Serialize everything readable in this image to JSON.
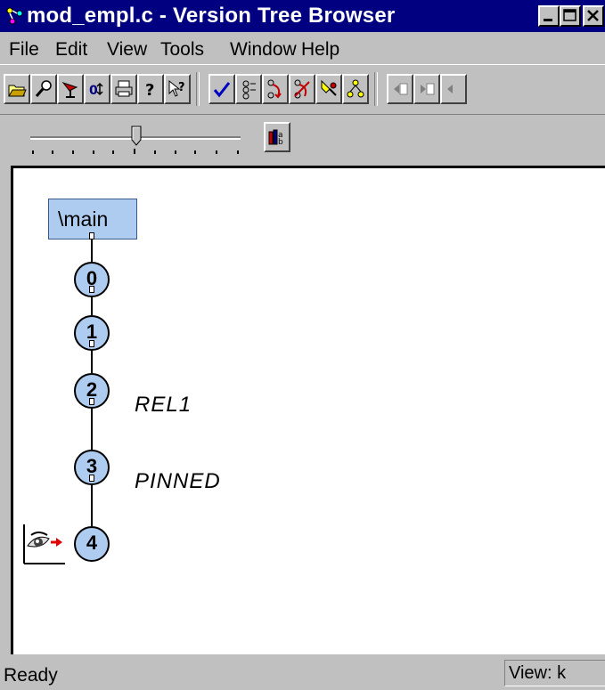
{
  "window": {
    "title": "mod_empl.c - Version Tree Browser"
  },
  "menu": [
    {
      "label": "File"
    },
    {
      "label": "Edit"
    },
    {
      "label": "View"
    },
    {
      "label": "Tools"
    },
    {
      "label": "Window"
    },
    {
      "label": "Help"
    }
  ],
  "toolbar": {
    "buttons": [
      "open-folder-icon",
      "magnifier-icon",
      "search-element-icon",
      "version-count-icon",
      "print-icon",
      "help-icon",
      "context-help-icon",
      "checkmark-icon",
      "show-labels-icon",
      "show-merges-icon",
      "hide-merges-icon",
      "show-checkedout-icon",
      "show-branches-icon",
      "scroll-left-icon",
      "scroll-right-icon"
    ]
  },
  "zoom": {
    "level": 0.5
  },
  "tree": {
    "branch": "\\main",
    "versions": [
      {
        "id": "0"
      },
      {
        "id": "1"
      },
      {
        "id": "2",
        "label": "REL1"
      },
      {
        "id": "3",
        "label": "PINNED"
      },
      {
        "id": "4"
      }
    ]
  },
  "status": {
    "text": "Ready",
    "view": "View: k"
  },
  "colors": {
    "titlebar": "#000080",
    "node_fill": "#aecbf0",
    "chrome": "#c0c0c0"
  }
}
